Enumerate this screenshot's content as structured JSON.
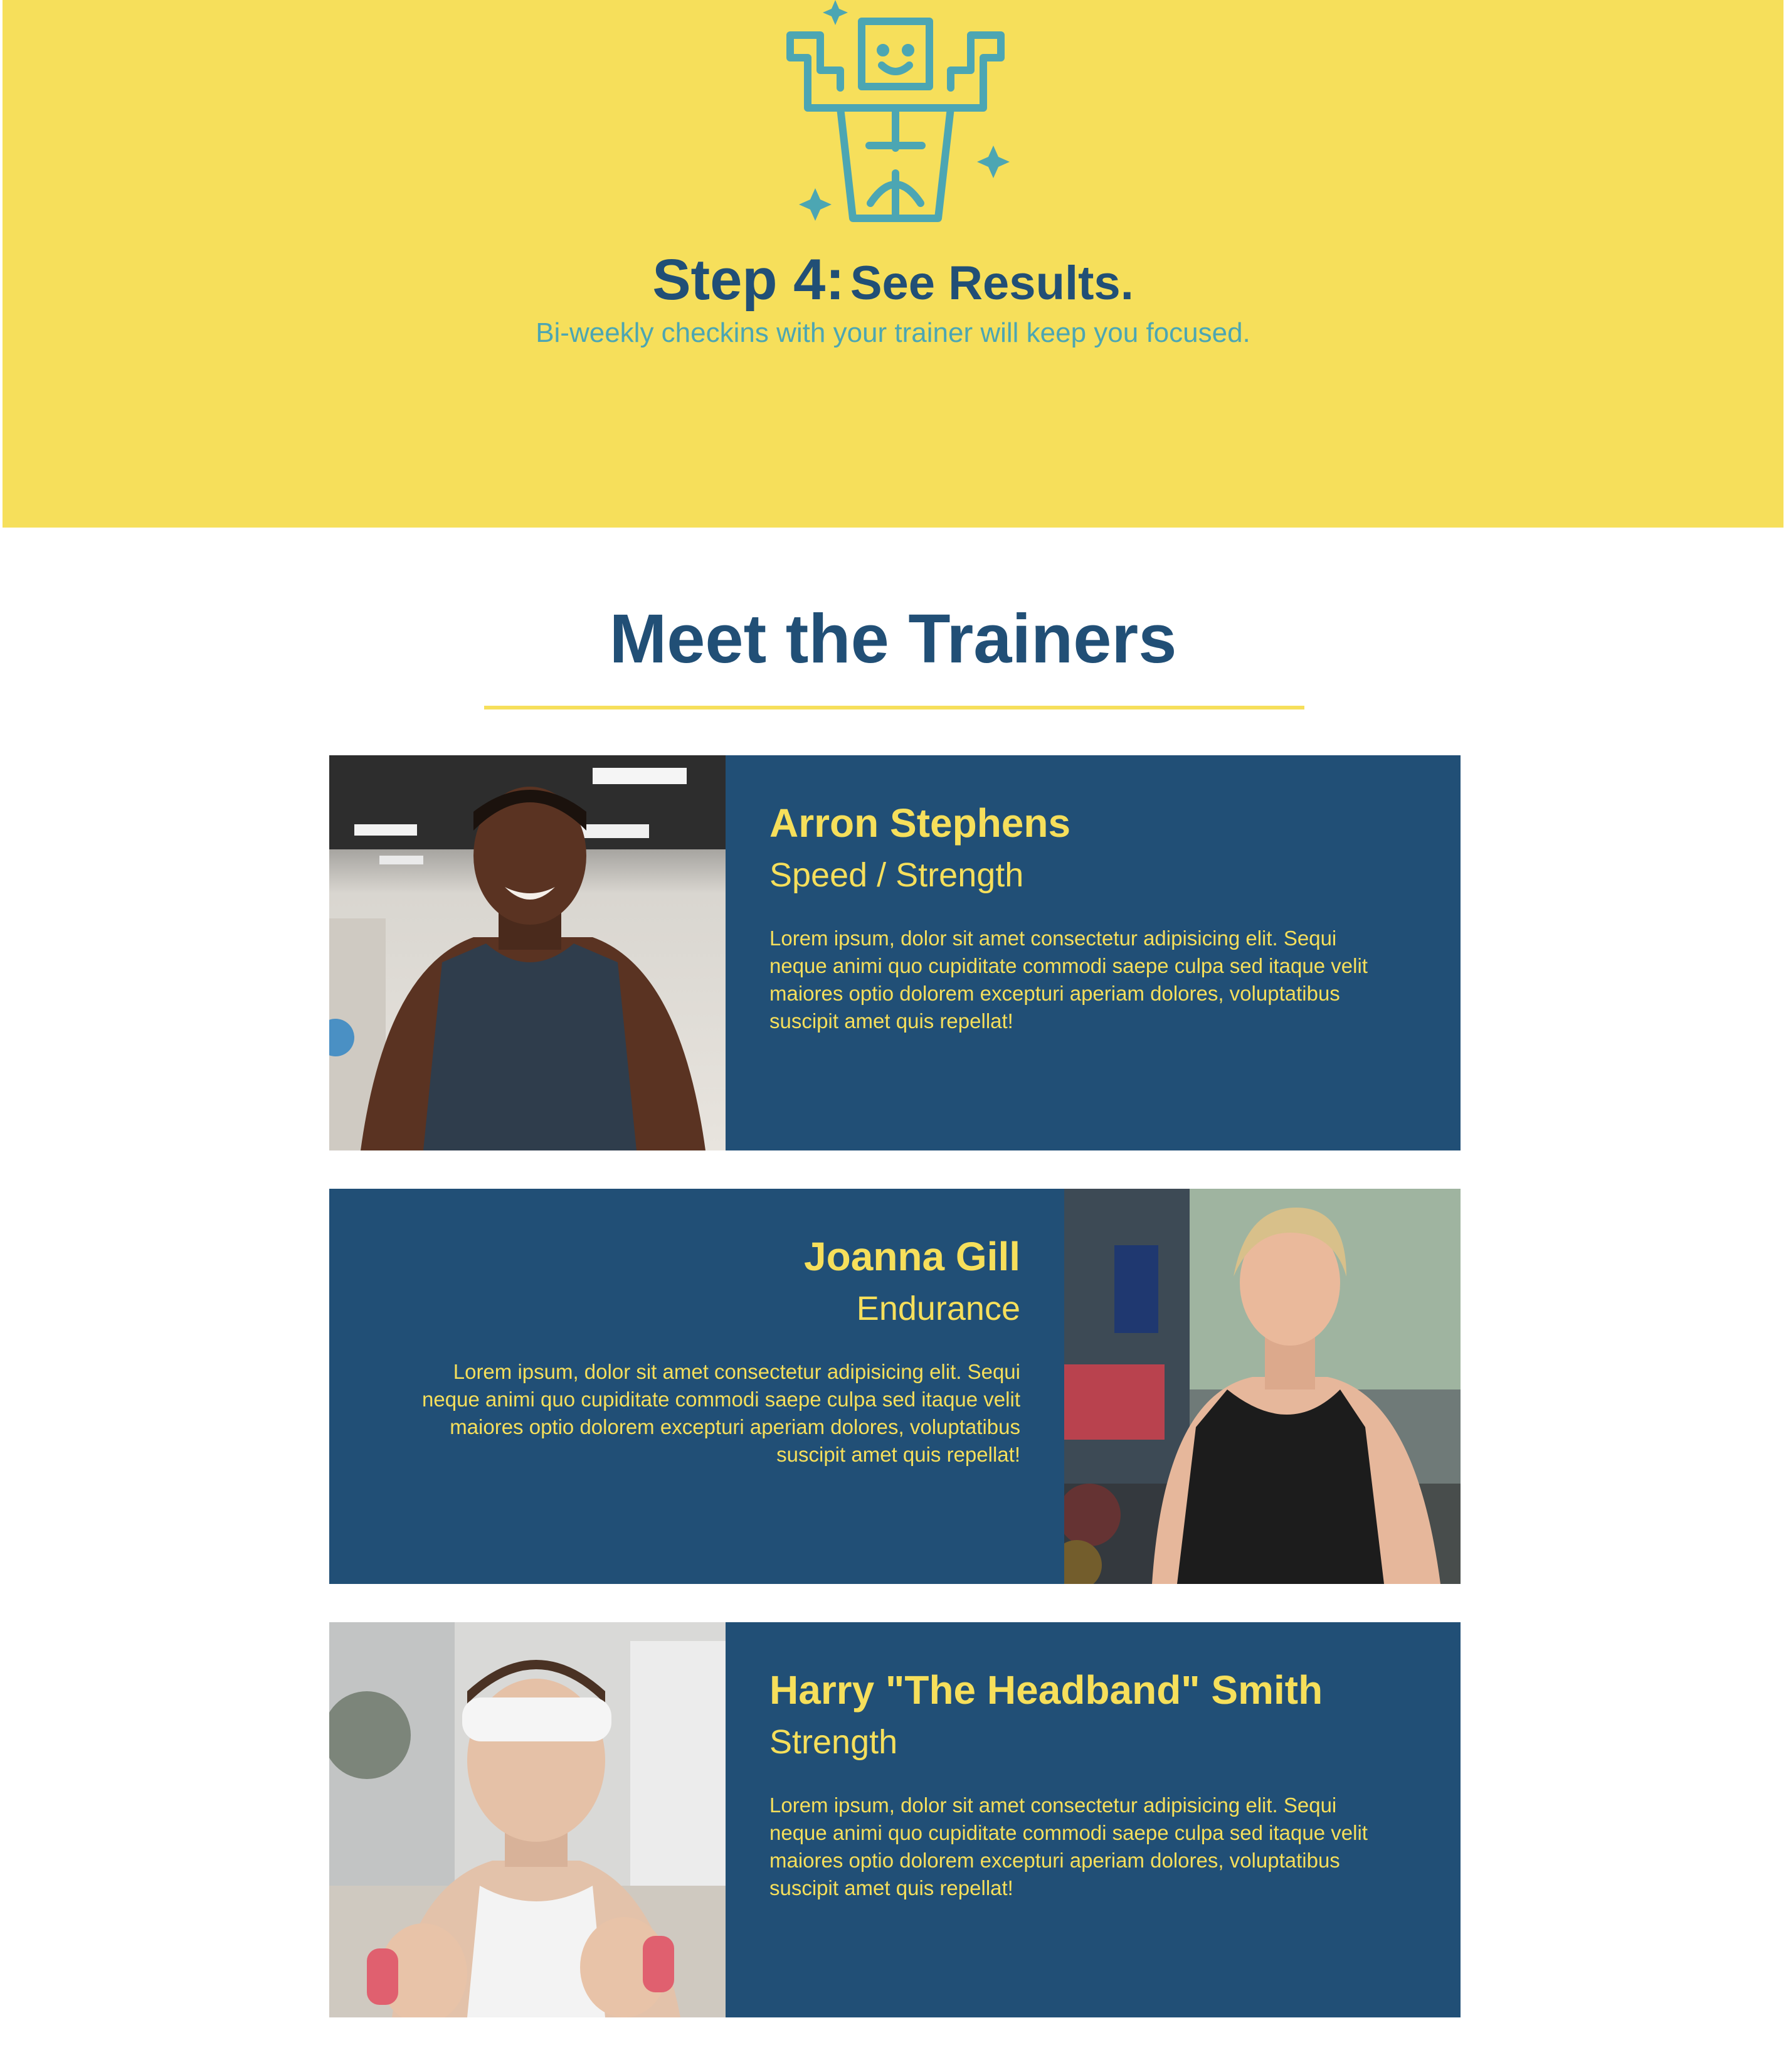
{
  "hero": {
    "icon": "strong-robot-icon",
    "step_label": "Step 4:",
    "step_title": "See Results.",
    "subtitle": "Bi-weekly checkins with your trainer will keep you focused."
  },
  "trainers_section": {
    "title": "Meet the Trainers",
    "trainers": [
      {
        "name": "Arron Stephens",
        "specialty": "Speed / Strength",
        "bio": "Lorem ipsum, dolor sit amet consectetur adipisicing elit. Sequi neque animi quo cupiditate commodi saepe culpa sed itaque velit maiores optio dolorem excepturi aperiam dolores, voluptatibus suscipit amet quis repellat!",
        "photo": "trainer-photo-man-gym"
      },
      {
        "name": "Joanna Gill",
        "specialty": "Endurance",
        "bio": "Lorem ipsum, dolor sit amet consectetur adipisicing elit. Sequi neque animi quo cupiditate commodi saepe culpa sed itaque velit maiores optio dolorem excepturi aperiam dolores, voluptatibus suscipit amet quis repellat!",
        "photo": "trainer-photo-woman-gym"
      },
      {
        "name": "Harry \"The Headband\" Smith",
        "specialty": "Strength",
        "bio": "Lorem ipsum, dolor sit amet consectetur adipisicing elit. Sequi neque animi quo cupiditate commodi saepe culpa sed itaque velit maiores optio dolorem excepturi aperiam dolores, voluptatibus suscipit amet quis repellat!",
        "photo": "trainer-photo-man-headband"
      }
    ]
  },
  "colors": {
    "yellow": "#f6df5b",
    "navy": "#214f76",
    "teal": "#4ca6b3"
  }
}
